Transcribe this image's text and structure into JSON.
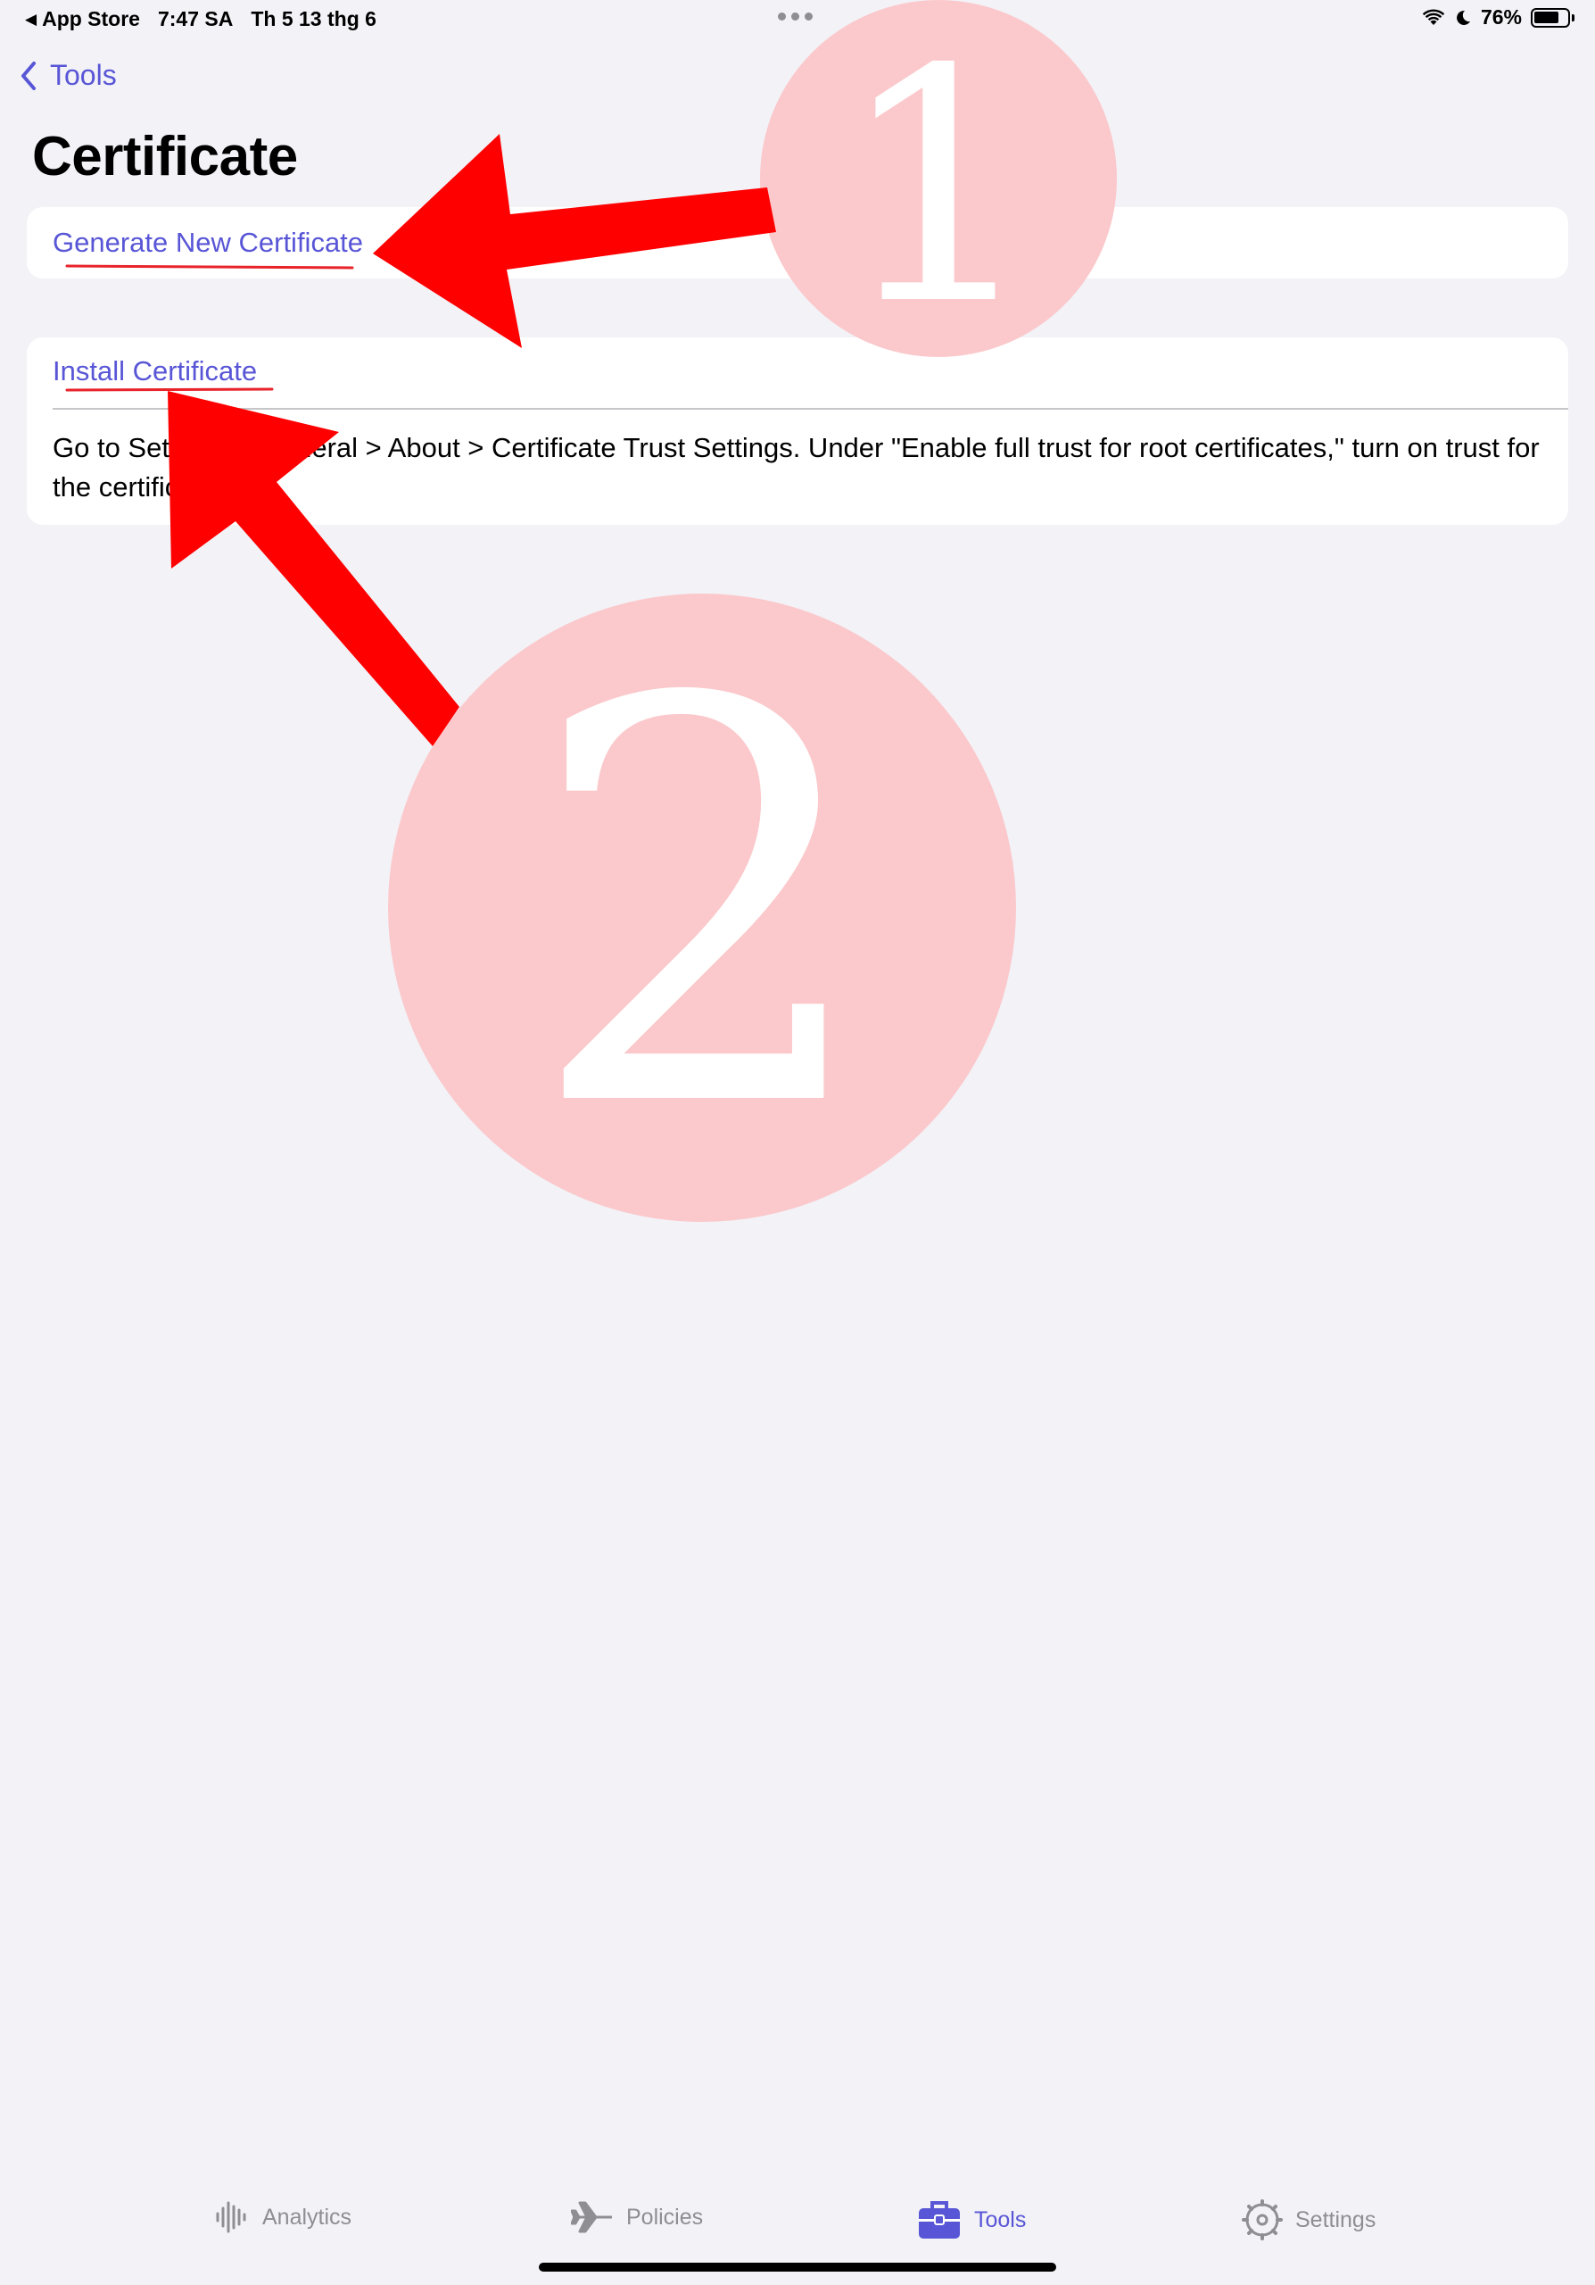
{
  "status_bar": {
    "back_app": "App Store",
    "time": "7:47 SA",
    "date": "Th 5 13 thg 6",
    "battery_percent": "76%",
    "battery_level": 0.76
  },
  "nav": {
    "back_label": "Tools"
  },
  "page": {
    "title": "Certificate"
  },
  "sections": {
    "generate_label": "Generate New Certificate",
    "install_label": "Install Certificate",
    "install_desc": "Go to Settings > General > About > Certificate Trust Settings. Under \"Enable full trust for root certificates,\" turn on trust for the certificate."
  },
  "annotations": {
    "step_1": "1",
    "step_2": "2",
    "color": "#ff0000",
    "circle_color": "#fbc9cc"
  },
  "tabbar": {
    "items": [
      {
        "label": "Analytics",
        "icon": "waveform-icon",
        "active": false
      },
      {
        "label": "Policies",
        "icon": "airplane-icon",
        "active": false
      },
      {
        "label": "Tools",
        "icon": "toolbox-icon",
        "active": true
      },
      {
        "label": "Settings",
        "icon": "gear-icon",
        "active": false
      }
    ],
    "accent": "#5856d6",
    "inactive": "#8e8e93"
  }
}
